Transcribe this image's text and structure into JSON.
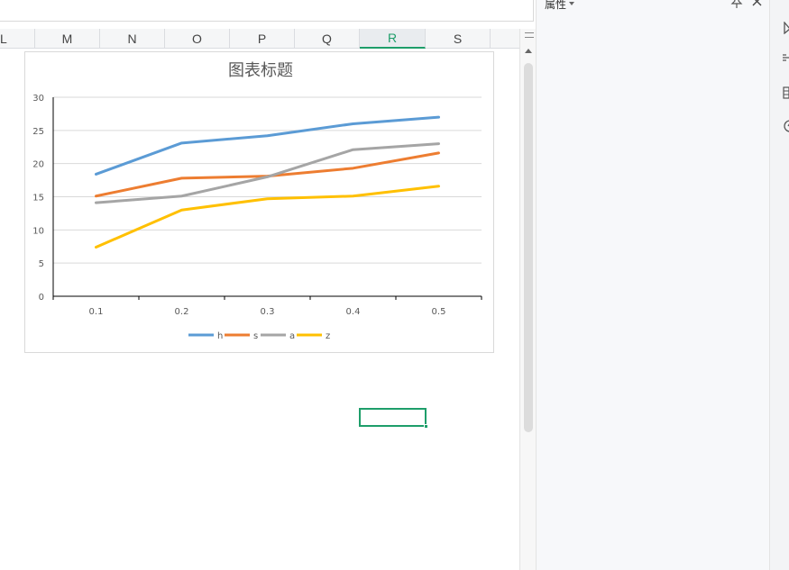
{
  "columns": [
    {
      "label": "L"
    },
    {
      "label": "M"
    },
    {
      "label": "N"
    },
    {
      "label": "O"
    },
    {
      "label": "P"
    },
    {
      "label": "Q"
    },
    {
      "label": "R"
    },
    {
      "label": "S"
    }
  ],
  "active_column": "R",
  "task_pane": {
    "title": "属性"
  },
  "colors": {
    "accent": "#1e9e6a"
  },
  "chart_data": {
    "type": "line",
    "title": "图表标题",
    "x": [
      "0.1",
      "0.2",
      "0.3",
      "0.4",
      "0.5"
    ],
    "ylim": [
      0,
      30
    ],
    "yticks": [
      "0",
      "5",
      "10",
      "15",
      "20",
      "25",
      "30"
    ],
    "grid": true,
    "legend_position": "bottom",
    "series": [
      {
        "name": "h",
        "color": "#5b9bd5",
        "values": [
          18.4,
          23.1,
          24.2,
          26.0,
          27.0
        ]
      },
      {
        "name": "s",
        "color": "#ed7d31",
        "values": [
          15.1,
          17.8,
          18.1,
          19.3,
          21.6
        ]
      },
      {
        "name": "a",
        "color": "#a5a5a5",
        "values": [
          14.1,
          15.1,
          18.0,
          22.1,
          23.0
        ]
      },
      {
        "name": "z",
        "color": "#ffc000",
        "values": [
          7.4,
          13.0,
          14.7,
          15.1,
          16.6
        ]
      }
    ]
  }
}
